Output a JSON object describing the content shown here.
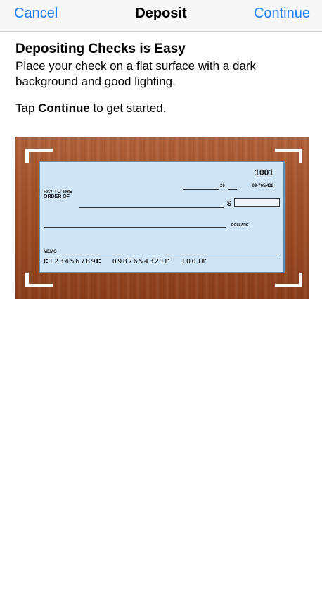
{
  "nav": {
    "left": "Cancel",
    "title": "Deposit",
    "right": "Continue"
  },
  "content": {
    "heading": "Depositing Checks is Easy",
    "description": "Place your check on a flat surface with a dark background and good lighting.",
    "tap_prefix": "Tap ",
    "tap_bold": "Continue",
    "tap_suffix": " to get started."
  },
  "check": {
    "number": "1001",
    "routing_fraction": "09-765/432",
    "date_prefix": "20",
    "pay_to_the_order_of": "PAY TO THE ORDER OF",
    "dollar_sign": "$",
    "dollars_label": "DOLLARS",
    "memo_label": "MEMO",
    "micr_line": "⑆123456789⑆  0987654321⑈  1001⑈"
  },
  "colors": {
    "accent": "#147efb",
    "nav_bg": "#f7f7f7",
    "check_bg": "#cfe5f5",
    "wood": "#a5542c"
  }
}
